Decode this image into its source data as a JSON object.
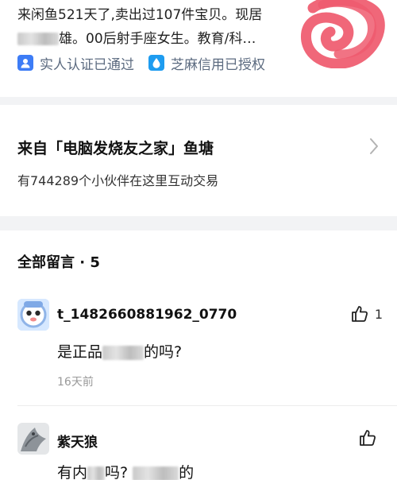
{
  "profile": {
    "desc_line1": "来闲鱼521天了,卖出过107件宝贝。现居",
    "desc_line2_suffix": "雄。00后射手座女生。教育/科…",
    "verify_real_name": "实人认证已通过",
    "verify_sesame": "芝麻信用已授权",
    "blot_color": "#ef5a6e"
  },
  "pond": {
    "title": "来自「电脑发烧友之家」鱼塘",
    "subtitle": "有744289个小伙伴在这里互动交易"
  },
  "comments": {
    "header": "全部留言 · 5",
    "items": [
      {
        "username": "t_1482660881962_0770",
        "text_prefix": "是正品",
        "text_suffix": "的吗?",
        "time": "16天前",
        "like_count": "1"
      },
      {
        "username": "紫天狼",
        "text_prefix": "有内",
        "text_mid": "吗?",
        "text_suffix": "的",
        "like_count": ""
      }
    ]
  },
  "colors": {
    "accent_blue": "#3d7cf6",
    "sesame_blue": "#1e9cf0",
    "muted_text": "#5c6b80",
    "background": "#f2f3f5"
  }
}
